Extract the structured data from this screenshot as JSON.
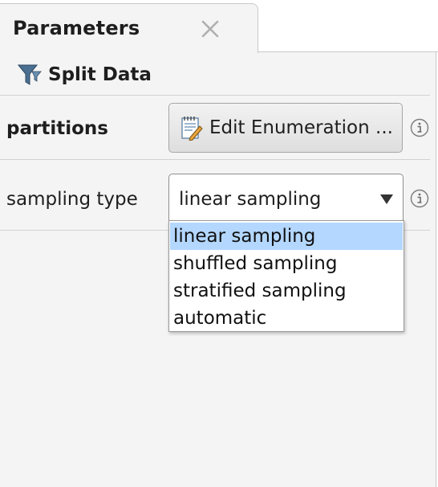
{
  "panel": {
    "tab_title": "Parameters",
    "operator": {
      "icon": "funnel-icon",
      "title": "Split Data"
    }
  },
  "parameters": {
    "partitions": {
      "label": "partitions",
      "button_label": "Edit Enumeration ...",
      "button_icon": "notepad-pencil-icon"
    },
    "sampling_type": {
      "label": "sampling type",
      "selected": "linear sampling",
      "options": [
        "linear sampling",
        "shuffled sampling",
        "stratified sampling",
        "automatic"
      ],
      "highlighted_index": 0
    }
  },
  "colors": {
    "panel_bg": "#f4f4f4",
    "highlight": "#b4d7ff",
    "border": "#c9c9c9"
  }
}
